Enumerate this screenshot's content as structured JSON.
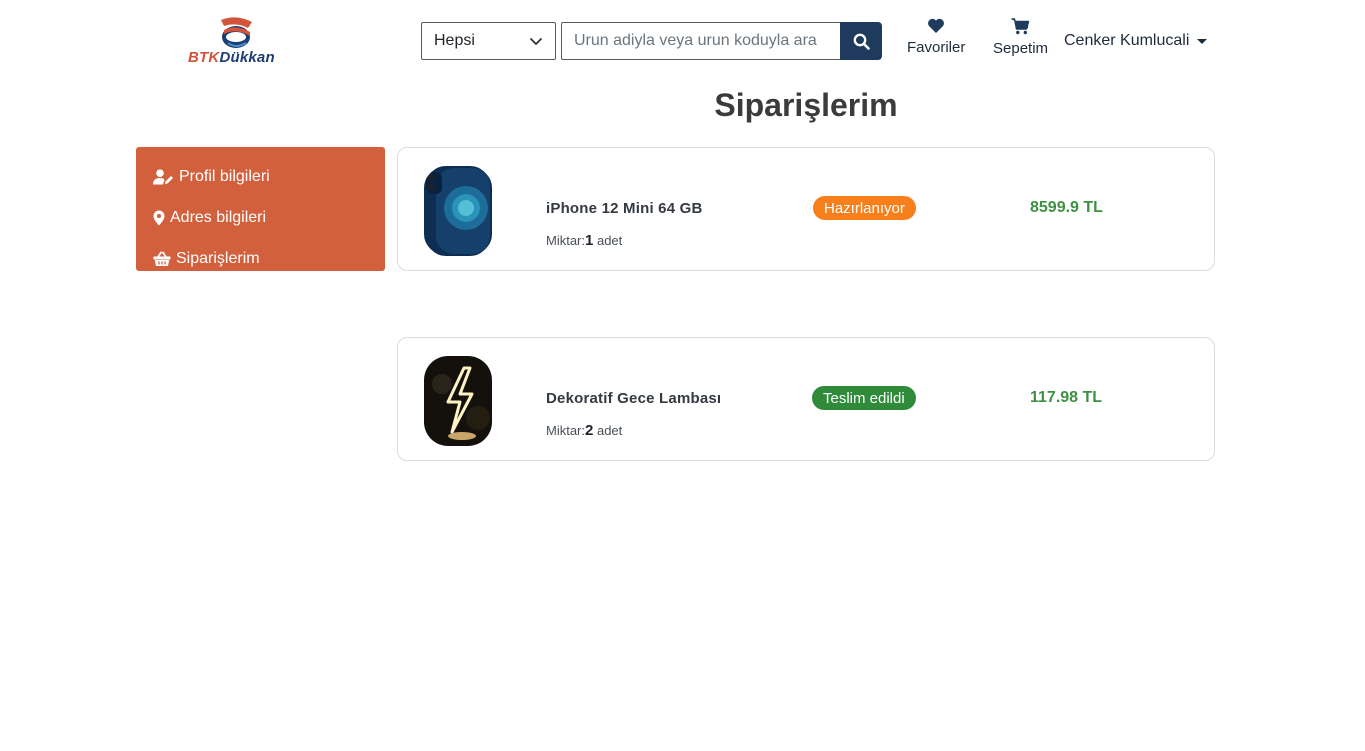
{
  "header": {
    "logo": {
      "brand_first": "BTK",
      "brand_second": "Dükkan"
    },
    "search": {
      "category_value": "Hepsi",
      "placeholder": "Urun adiyla veya urun koduyla ara",
      "input_value": ""
    },
    "favorites_label": "Favoriler",
    "cart_label": "Sepetim",
    "user_name": "Cenker Kumlucali"
  },
  "page_title": "Siparişlerim",
  "sidebar": {
    "items": [
      {
        "label": "Profil bilgileri",
        "icon": "user-edit-icon"
      },
      {
        "label": "Adres bilgileri",
        "icon": "map-marker-icon"
      },
      {
        "label": "Siparişlerim",
        "icon": "shopping-basket-icon"
      }
    ]
  },
  "orders": [
    {
      "product_name": "iPhone 12 Mini 64 GB",
      "qty_label": "Miktar:",
      "qty": "1",
      "unit": "adet",
      "status": "Hazırlanıyor",
      "status_color": "#f77f1c",
      "price": "8599.9 TL"
    },
    {
      "product_name": "Dekoratif Gece Lambası",
      "qty_label": "Miktar:",
      "qty": "2",
      "unit": "adet",
      "status": "Teslim edildi",
      "status_color": "#2f8a3a",
      "price": "117.98 TL"
    }
  ],
  "colors": {
    "sidebar_bg": "#d2603c",
    "search_button": "#1e3a5c",
    "price": "#3f9142"
  }
}
